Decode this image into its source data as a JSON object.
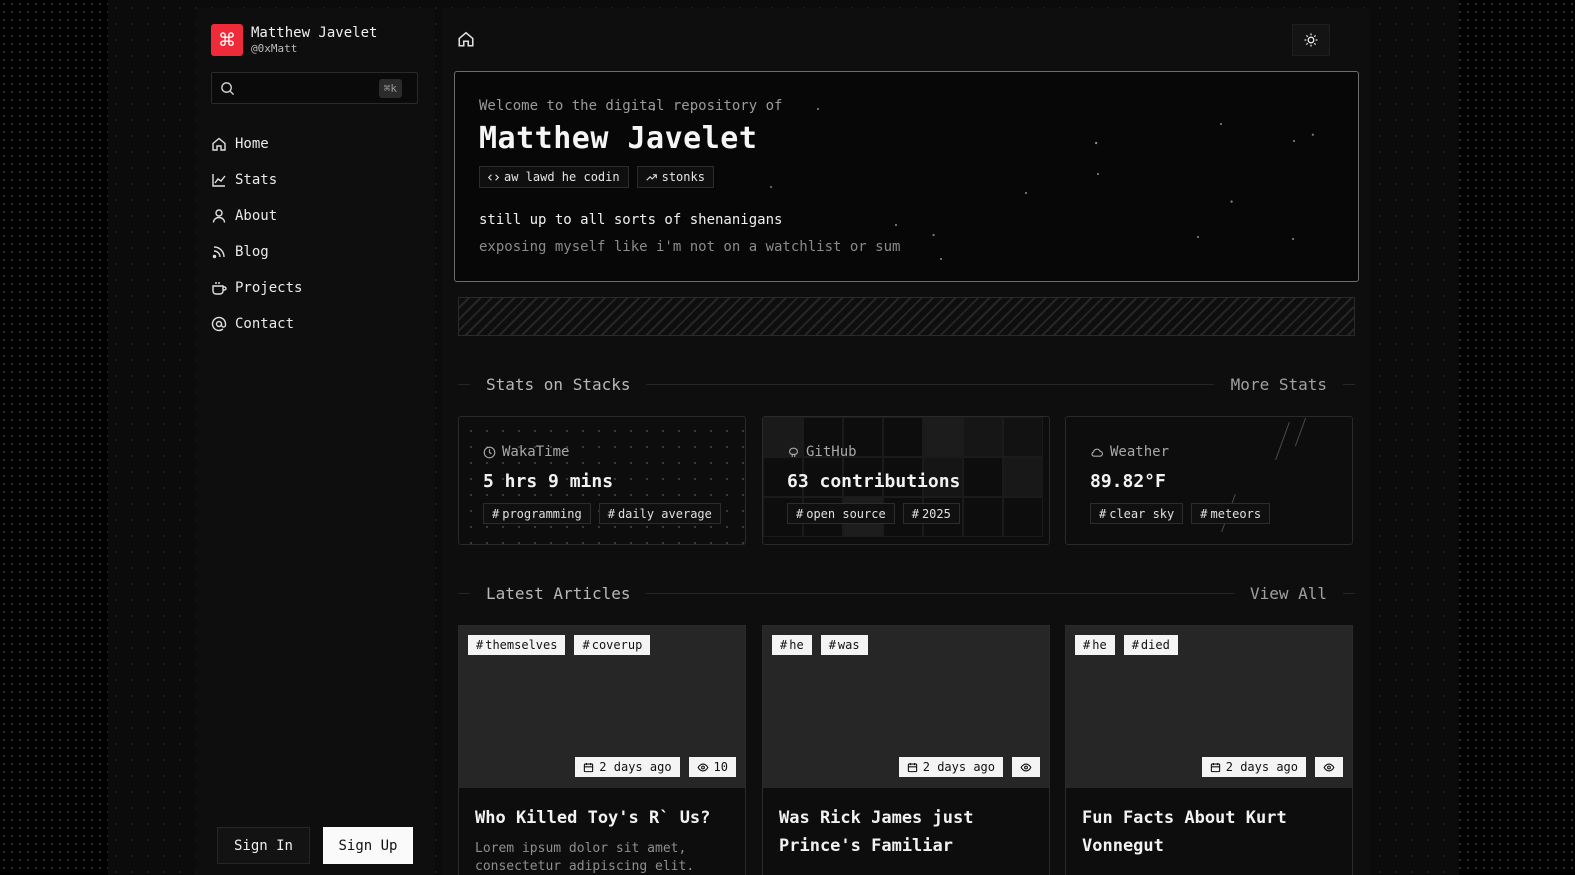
{
  "profile": {
    "name": "Matthew Javelet",
    "handle": "@0xMatt",
    "logo_glyph": "⌘"
  },
  "search": {
    "shortcut": "⌘k",
    "placeholder": ""
  },
  "nav": [
    {
      "label": "Home",
      "icon": "home-icon"
    },
    {
      "label": "Stats",
      "icon": "chart-icon"
    },
    {
      "label": "About",
      "icon": "user-icon"
    },
    {
      "label": "Blog",
      "icon": "rss-icon"
    },
    {
      "label": "Projects",
      "icon": "coffee-icon"
    },
    {
      "label": "Contact",
      "icon": "at-sign-icon"
    }
  ],
  "auth": {
    "sign_in": "Sign In",
    "sign_up": "Sign Up"
  },
  "hero": {
    "kicker": "Welcome to the digital repository of",
    "title": "Matthew Javelet",
    "tags": [
      {
        "label": "aw lawd he codin",
        "icon": "code-icon"
      },
      {
        "label": "stonks",
        "icon": "trending-up-icon"
      }
    ],
    "line1": "still up to all sorts of shenanigans",
    "line2": "exposing myself like i'm not on a watchlist or sum"
  },
  "stats_section": {
    "title": "Stats on Stacks",
    "link": "More Stats"
  },
  "stats": [
    {
      "label": "WakaTime",
      "icon": "clock-icon",
      "value": "5 hrs 9 mins",
      "tags": [
        "programming",
        "daily average"
      ]
    },
    {
      "label": "GitHub",
      "icon": "github-icon",
      "value": "63 contributions",
      "tags": [
        "open source",
        "2025"
      ]
    },
    {
      "label": "Weather",
      "icon": "cloud-icon",
      "value": "89.82°F",
      "tags": [
        "clear sky",
        "meteors"
      ]
    }
  ],
  "articles_section": {
    "title": "Latest Articles",
    "link": "View All"
  },
  "articles": [
    {
      "tags": [
        "themselves",
        "coverup"
      ],
      "date": "2 days ago",
      "views": "10",
      "title": "Who Killed Toy's R` Us?",
      "excerpt": "Lorem ipsum dolor sit amet, consectetur adipiscing elit."
    },
    {
      "tags": [
        "he",
        "was"
      ],
      "date": "2 days ago",
      "views": "",
      "title": "Was Rick James just Prince's Familiar",
      "excerpt": ""
    },
    {
      "tags": [
        "he",
        "died"
      ],
      "date": "2 days ago",
      "views": "",
      "title": "Fun Facts About Kurt Vonnegut",
      "excerpt": ""
    }
  ],
  "colors": {
    "brand": "#ef2b3a",
    "background": "#000000",
    "panel": "#0e0e0e",
    "card_thumb": "#262626"
  }
}
